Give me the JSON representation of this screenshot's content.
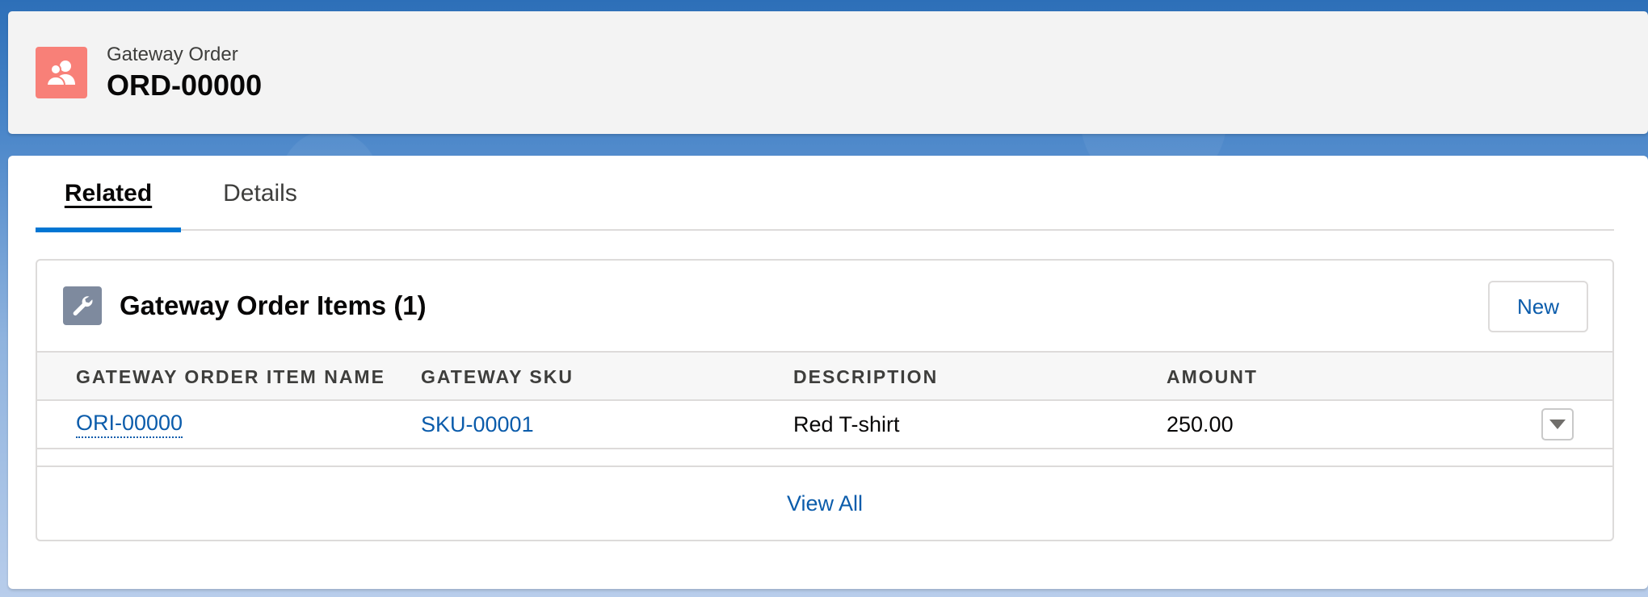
{
  "header": {
    "object_label": "Gateway Order",
    "record_name": "ORD-00000",
    "icon": "contacts-icon",
    "icon_color": "#f88078"
  },
  "tabs": [
    {
      "label": "Related",
      "active": true
    },
    {
      "label": "Details",
      "active": false
    }
  ],
  "related_list": {
    "icon": "wrench-icon",
    "icon_color": "#7e8a9e",
    "title": "Gateway Order Items (1)",
    "new_label": "New",
    "columns": [
      "GATEWAY ORDER ITEM NAME",
      "GATEWAY SKU",
      "DESCRIPTION",
      "AMOUNT"
    ],
    "rows": [
      {
        "name": "ORI-00000",
        "sku": "SKU-00001",
        "description": "Red T-shirt",
        "amount": "250.00"
      }
    ],
    "view_all_label": "View All"
  },
  "colors": {
    "link": "#0b5cab",
    "tab_active_indicator": "#0176d3"
  }
}
